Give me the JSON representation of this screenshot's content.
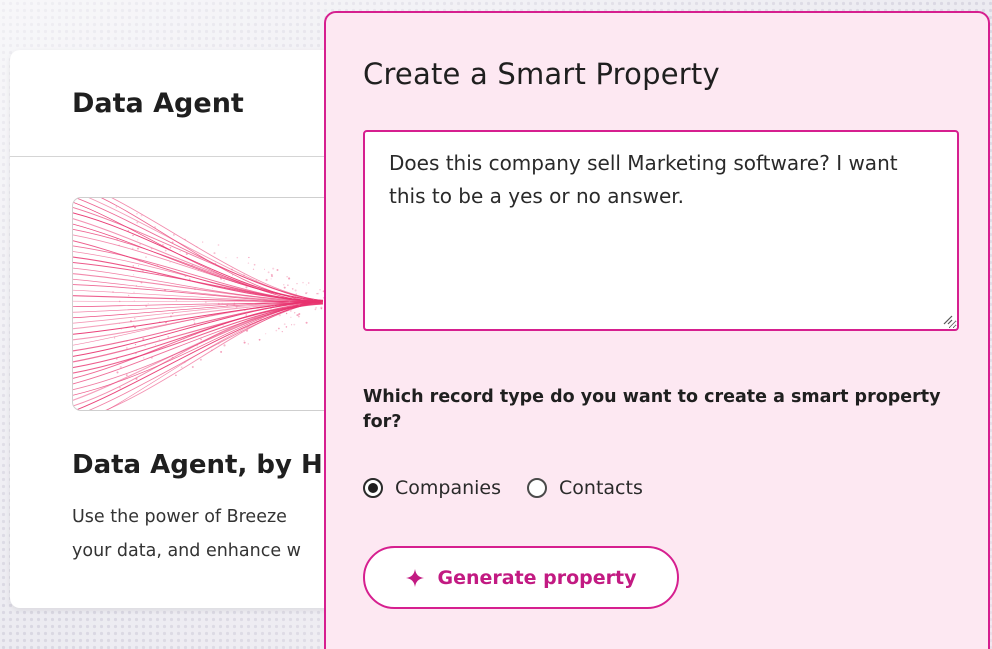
{
  "left_card": {
    "title": "Data Agent",
    "hero_title": "Data Agent, by HubSpot",
    "hero_desc_line1": "Use the power of Breeze",
    "hero_desc_line2": "your data, and enhance w"
  },
  "modal": {
    "title": "Create a Smart Property",
    "prompt_value": "Does this company sell Marketing software? I want this to be a yes or no answer.",
    "question": "Which record type do you want to create a smart property for?",
    "options": [
      {
        "label": "Companies",
        "selected": true
      },
      {
        "label": "Contacts",
        "selected": false
      }
    ],
    "generate_label": "Generate property"
  },
  "icons": {
    "sparkle": "sparkle-icon",
    "resize": "resize-handle-icon"
  },
  "colors": {
    "accent": "#d61f8f",
    "modal_bg": "#fde8f2",
    "button_text": "#c21a82"
  }
}
